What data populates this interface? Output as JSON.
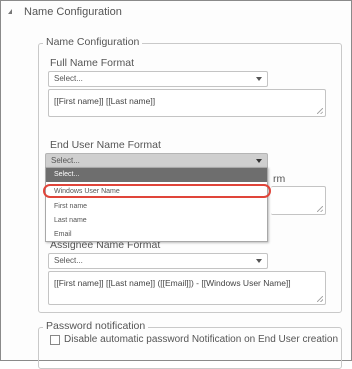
{
  "section": {
    "title": "Name Configuration"
  },
  "name_config": {
    "legend": "Name Configuration",
    "full_name_format": {
      "label": "Full Name Format",
      "select_value": "Select...",
      "value": "[[First name]] [[Last name]]"
    },
    "end_user_name_format": {
      "label": "End User Name Format",
      "select_value": "Select...",
      "partial_label_suffix": "rm",
      "dropdown_options": [
        "Select...",
        "Windows User Name",
        "First name",
        "Last name",
        "Email"
      ],
      "highlighted_option": "Select...",
      "circled_option": "Windows User Name"
    },
    "assignee_name_format": {
      "label": "Assignee Name Format",
      "select_value": "Select...",
      "value": "[[First name]] [[Last name]] ([[Email]]) - [[Windows User Name]]"
    }
  },
  "password_notification": {
    "legend": "Password notification",
    "checkbox_label": "Disable automatic password Notification on End User creation",
    "checked": false
  },
  "colors": {
    "highlight_ring": "#e0453a",
    "dropdown_highlight": "#6e6e6e"
  }
}
